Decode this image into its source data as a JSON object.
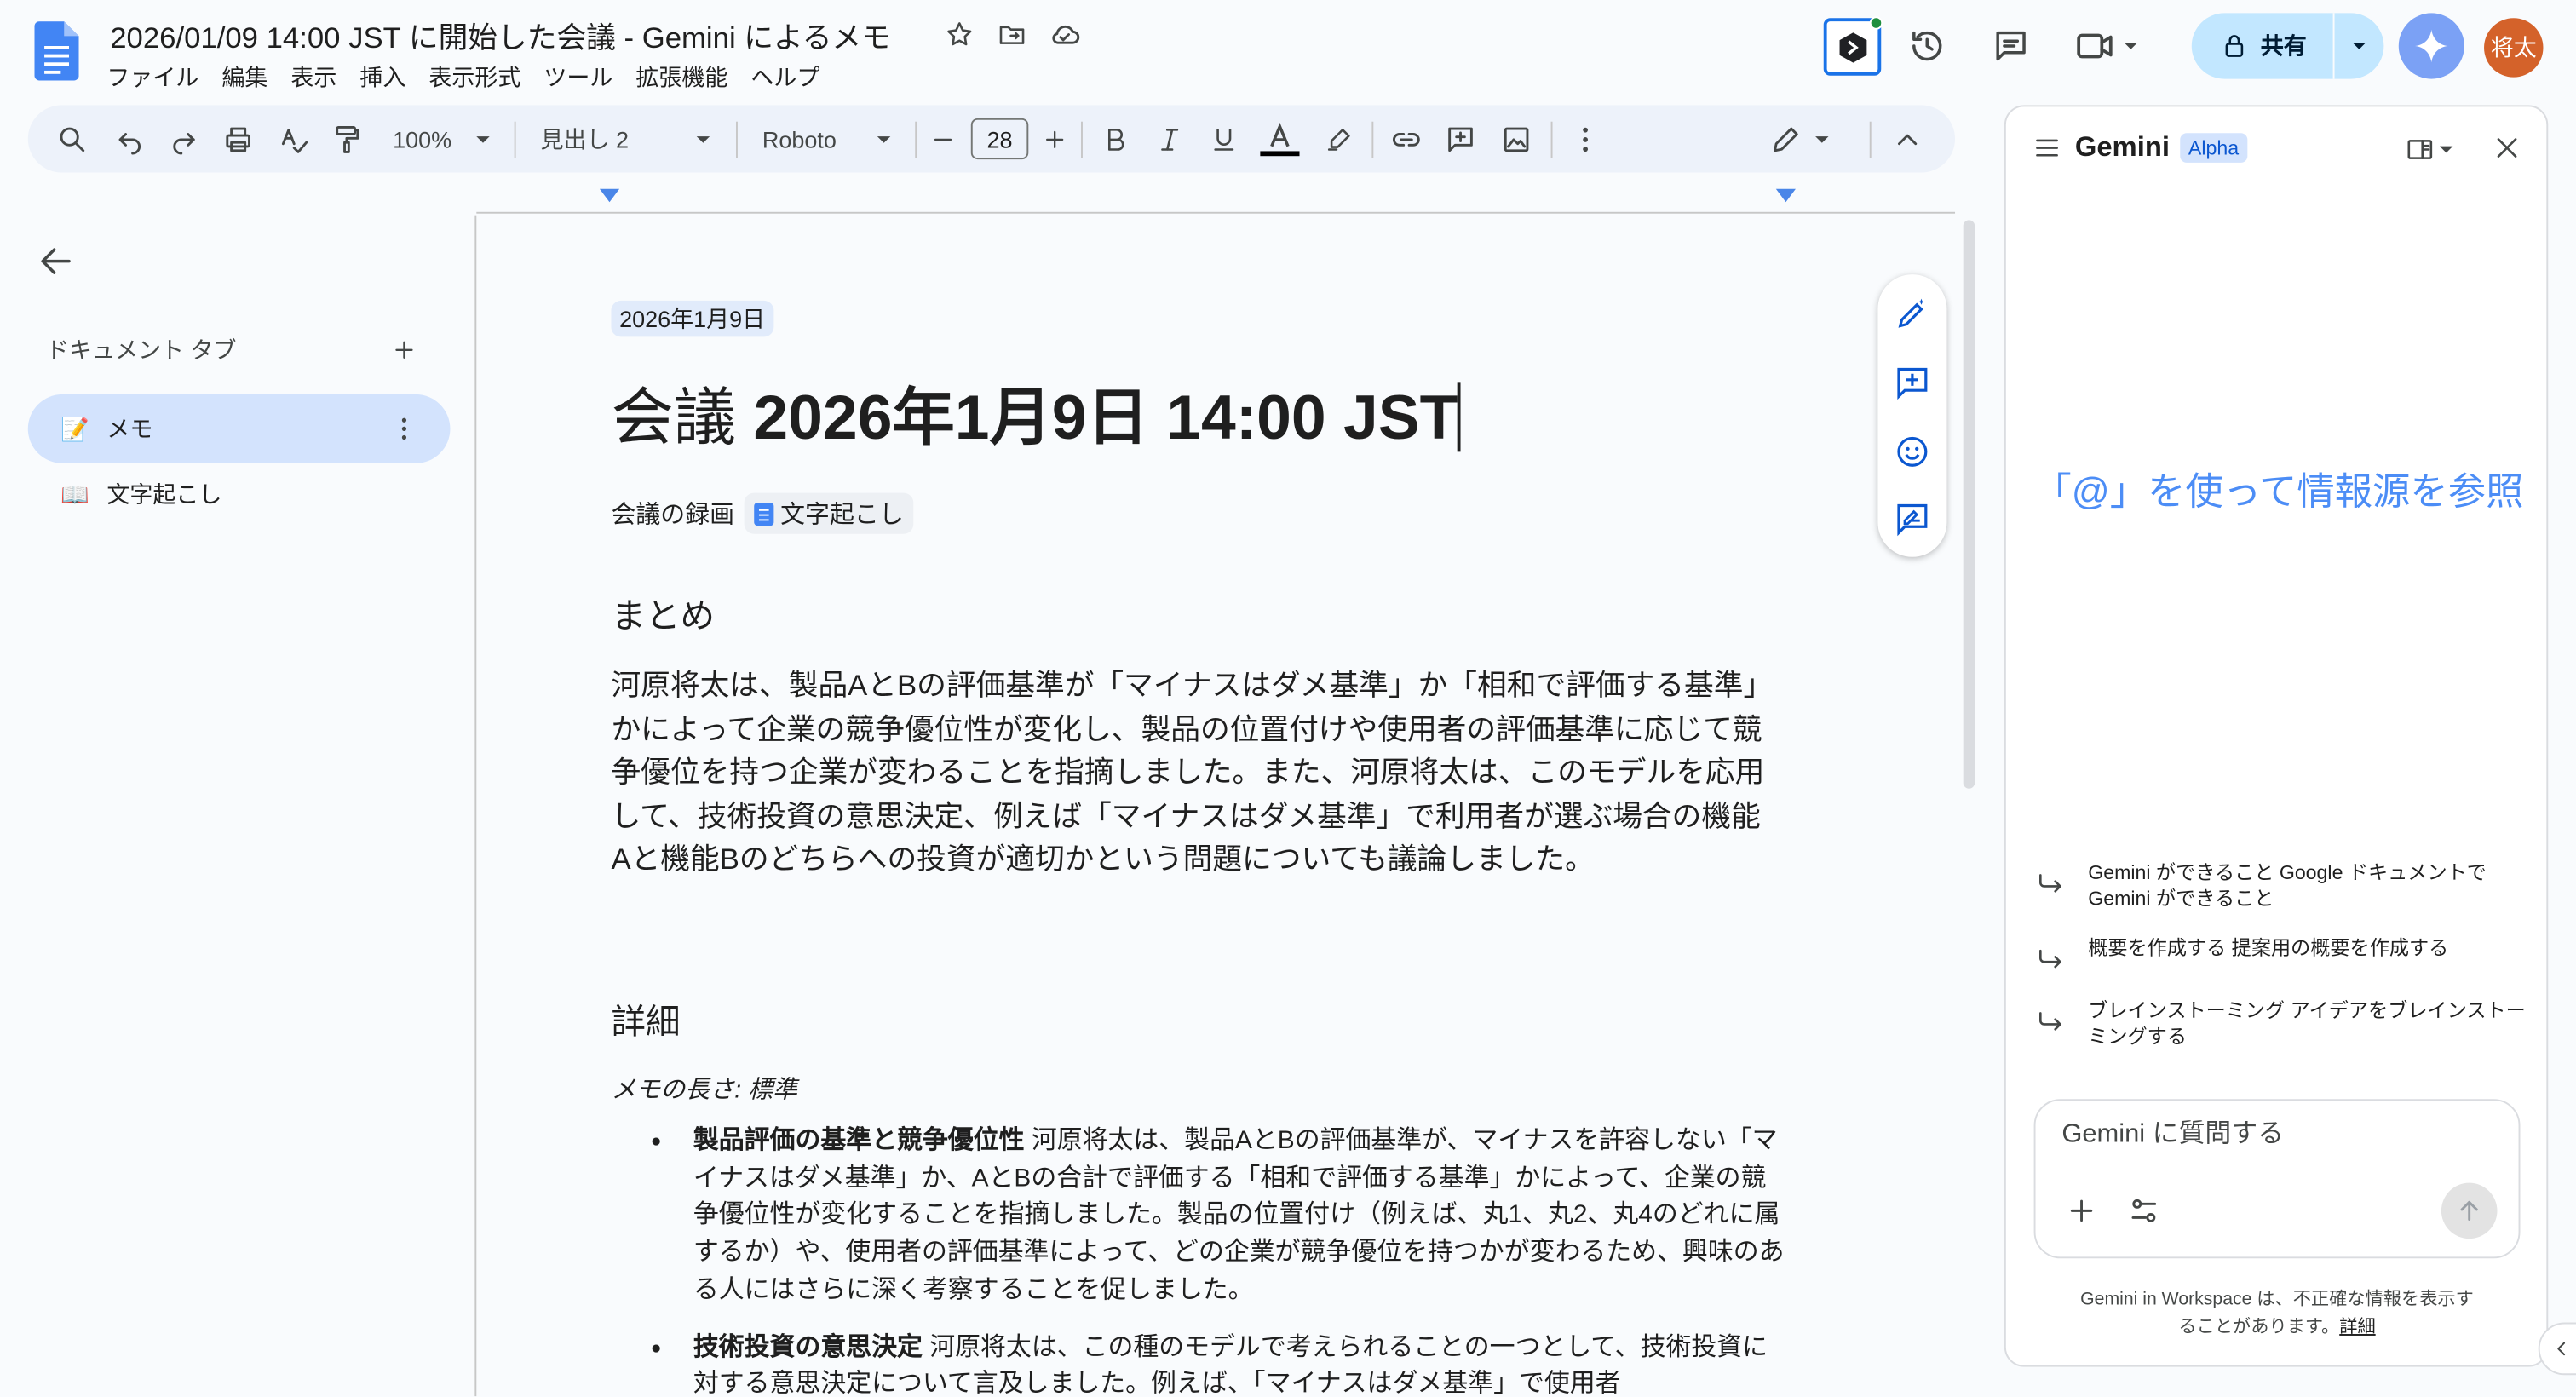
{
  "header": {
    "title": "2026/01/09 14:00 JST に開始した会議 - Gemini によるメモ",
    "menu": [
      "ファイル",
      "編集",
      "表示",
      "挿入",
      "表示形式",
      "ツール",
      "拡張機能",
      "ヘルプ"
    ],
    "share_label": "共有",
    "avatar_text": "将太"
  },
  "toolbar": {
    "zoom": "100%",
    "style": "見出し 2",
    "font": "Roboto",
    "font_size": "28"
  },
  "sidebar": {
    "tabs_label": "ドキュメント タブ",
    "tabs": [
      {
        "emoji": "📝",
        "label": "メモ"
      },
      {
        "emoji": "📖",
        "label": "文字起こし"
      }
    ]
  },
  "document": {
    "date_chip": "2026年1月9日",
    "title_prefix": "会議",
    "title_rest": "2026年1月9日 14:00 JST",
    "recording_label": "会議の録画",
    "transcript_chip": "文字起こし",
    "summary_heading": "まとめ",
    "summary": "河原将太は、製品AとBの評価基準が「マイナスはダメ基準」か「相和で評価する基準」かによって企業の競争優位性が変化し、製品の位置付けや使用者の評価基準に応じて競争優位を持つ企業が変わることを指摘しました。また、河原将太は、このモデルを応用して、技術投資の意思決定、例えば「マイナスはダメ基準」で利用者が選ぶ場合の機能Aと機能Bのどちらへの投資が適切かという問題についても議論しました。",
    "details_heading": "詳細",
    "memo_length": "メモの長さ: 標準",
    "bullets": [
      {
        "title": "製品評価の基準と競争優位性",
        "text": " 河原将太は、製品AとBの評価基準が、マイナスを許容しない「マイナスはダメ基準」か、AとBの合計で評価する「相和で評価する基準」かによって、企業の競争優位性が変化することを指摘しました。製品の位置付け（例えば、丸1、丸2、丸4のどれに属するか）や、使用者の評価基準によって、どの企業が競争優位を持つかが変わるため、興味のある人にはさらに深く考察することを促しました。"
      },
      {
        "title": "技術投資の意思決定",
        "text": " 河原将太は、この種のモデルで考えられることの一つとして、技術投資に対する意思決定について言及しました。例えば、「マイナスはダメ基準」で使用者"
      }
    ]
  },
  "gemini": {
    "title": "Gemini",
    "badge": "Alpha",
    "hint": "「@」を使って情報源を参照",
    "suggestions": [
      "Gemini ができること Google ドキュメントで Gemini ができること",
      "概要を作成する 提案用の概要を作成する",
      "ブレインストーミング アイデアをブレインストーミングする"
    ],
    "input_placeholder": "Gemini に質問する",
    "footer": "Gemini in Workspace は、不正確な情報を表示することがあります。",
    "footer_link": "詳細"
  },
  "colors": {
    "accent": "#0b57d0",
    "share_bg": "#c2e7ff",
    "gemini_hint": "#4c8df6",
    "avatar_bg": "#d4622a"
  }
}
